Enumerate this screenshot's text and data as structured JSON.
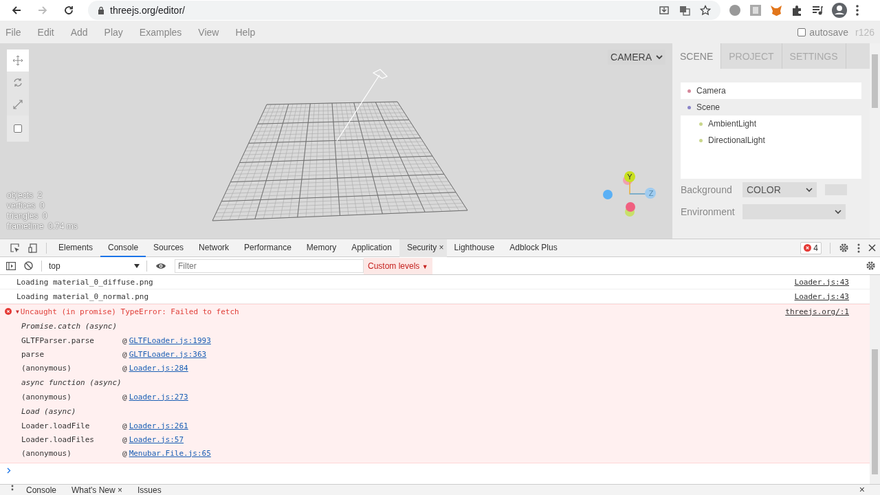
{
  "browser": {
    "url": "threejs.org/editor/"
  },
  "menubar": {
    "items": [
      "File",
      "Edit",
      "Add",
      "Play",
      "Examples",
      "View",
      "Help"
    ],
    "autosave": {
      "label": "autosave",
      "checked": false
    },
    "version": "r126"
  },
  "viewport": {
    "tools": [
      {
        "kind": "translate",
        "selected": true
      },
      {
        "kind": "rotate",
        "selected": false
      },
      {
        "kind": "scale",
        "selected": false
      },
      {
        "kind": "local",
        "checked": false
      }
    ],
    "camera": "CAMERA",
    "axis_labels": [
      "Y",
      "Z"
    ],
    "info": [
      {
        "label": "objects",
        "value": "2"
      },
      {
        "label": "vertices",
        "value": "0"
      },
      {
        "label": "triangles",
        "value": "0"
      },
      {
        "label": "frametime",
        "value": "0.74 ms"
      }
    ]
  },
  "sidebar": {
    "tabs": [
      {
        "label": "SCENE",
        "selected": true
      },
      {
        "label": "PROJECT",
        "selected": false
      },
      {
        "label": "SETTINGS",
        "selected": false
      }
    ],
    "outliner": [
      {
        "name": "Camera",
        "color": "#d4879a",
        "selected": false
      },
      {
        "name": "Scene",
        "color": "#8b84c9",
        "selected": true,
        "children": [
          {
            "name": "AmbientLight",
            "color": "#c9d68c",
            "selected": false
          },
          {
            "name": "DirectionalLight",
            "color": "#c9d68c",
            "selected": false
          }
        ]
      }
    ],
    "properties": [
      {
        "label": "Background",
        "kind": "color",
        "value": "COLOR"
      },
      {
        "label": "Environment",
        "kind": "select"
      }
    ]
  },
  "devtools": {
    "tabs": [
      {
        "label": "Elements",
        "selected": false
      },
      {
        "label": "Console",
        "selected": true
      },
      {
        "label": "Sources",
        "selected": false
      },
      {
        "label": "Network",
        "selected": false
      },
      {
        "label": "Performance",
        "selected": false
      },
      {
        "label": "Memory",
        "selected": false
      },
      {
        "label": "Application",
        "selected": false
      },
      {
        "label": "Security",
        "selected": false,
        "close": "×"
      },
      {
        "label": "Lighthouse",
        "selected": false
      },
      {
        "label": "Adblock Plus",
        "selected": false
      }
    ],
    "error_count": "4",
    "toolbar": {
      "context": "top",
      "filter_placeholder": "Filter",
      "levels": "Custom levels",
      "levels_caret": "▼"
    },
    "messages": [
      {
        "kind": "log",
        "text": "Loading material_0_diffuse.png",
        "source": "Loader.js:43"
      },
      {
        "kind": "log",
        "text": "Loading material_0_normal.png",
        "source": "Loader.js:43"
      },
      {
        "kind": "error",
        "toggle": "▼",
        "text": "Uncaught (in promise) TypeError: Failed to fetch",
        "source": "threejs.org/:1",
        "stack": [
          {
            "kind": "async",
            "text": "Promise.catch (async)"
          },
          {
            "kind": "frame",
            "function": "GLTFParser.parse",
            "at": "@",
            "link": "GLTFLoader.js:1993"
          },
          {
            "kind": "frame",
            "function": "parse",
            "at": "@",
            "link": "GLTFLoader.js:363"
          },
          {
            "kind": "frame",
            "function": "(anonymous)",
            "at": "@",
            "link": "Loader.js:284"
          },
          {
            "kind": "async",
            "text": "async function (async)"
          },
          {
            "kind": "frame",
            "function": "(anonymous)",
            "at": "@",
            "link": "Loader.js:273"
          },
          {
            "kind": "async",
            "text": "Load (async)"
          },
          {
            "kind": "frame",
            "function": "Loader.loadFile",
            "at": "@",
            "link": "Loader.js:261"
          },
          {
            "kind": "frame",
            "function": "Loader.loadFiles",
            "at": "@",
            "link": "Loader.js:57"
          },
          {
            "kind": "frame",
            "function": "(anonymous)",
            "at": "@",
            "link": "Menubar.File.js:65"
          }
        ]
      }
    ],
    "drawer": {
      "tabs": [
        {
          "label": "Console"
        },
        {
          "label": "What's New",
          "close": "×"
        },
        {
          "label": "Issues"
        }
      ],
      "close": "×"
    }
  }
}
